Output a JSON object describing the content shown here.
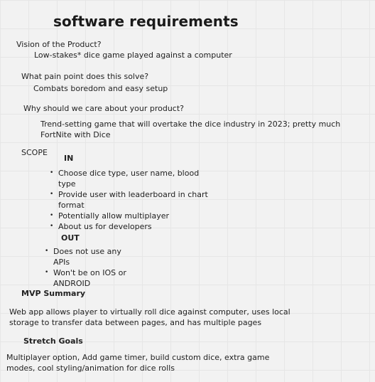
{
  "title": "software requirements",
  "vision": {
    "question": "Vision of the Product?",
    "answer": "Low-stakes* dice game played against a computer"
  },
  "pain_point": {
    "question": "What pain point does this solve?",
    "answer": "Combats boredom and easy setup"
  },
  "why_care": {
    "question": "Why should we care about your product?",
    "answer": "Trend-setting game that will overtake the dice industry in 2023; pretty much FortNite with Dice"
  },
  "scope": {
    "label": "SCOPE",
    "in_label": "IN",
    "in_items": [
      "Choose dice type, user name, blood type",
      "Provide user with leaderboard in chart format",
      "Potentially allow multiplayer",
      "About us for developers"
    ],
    "out_label": "OUT",
    "out_items": [
      "Does not use any APIs",
      "Won't be on IOS or ANDROID"
    ]
  },
  "mvp": {
    "heading": "MVP Summary",
    "text": "Web app allows player to virtually roll dice against computer, uses local storage to transfer data between pages, and has multiple pages"
  },
  "stretch": {
    "heading": "Stretch Goals",
    "text": "Multiplayer option, Add game timer, build custom dice, extra game modes, cool styling/animation for dice rolls"
  }
}
